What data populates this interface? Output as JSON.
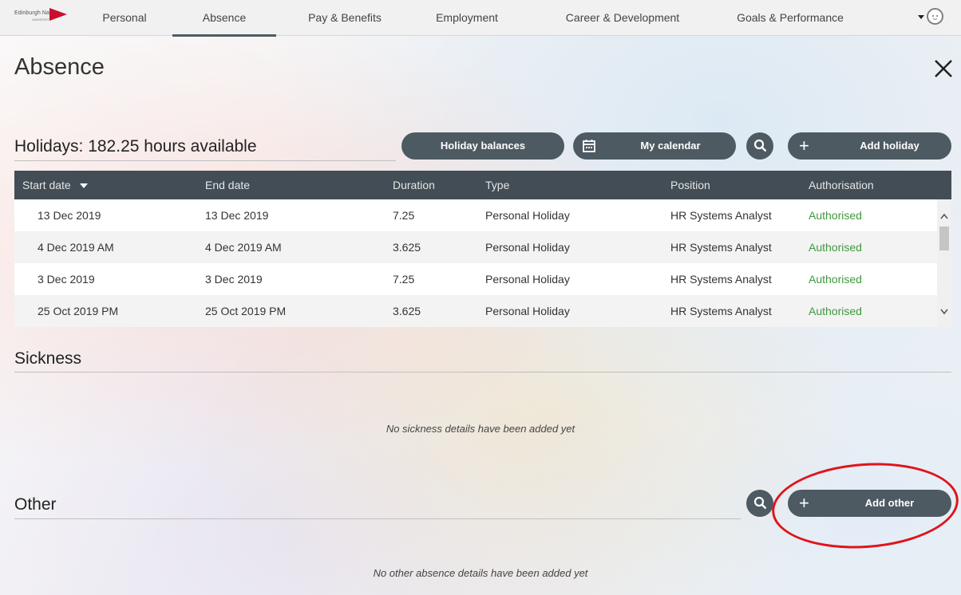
{
  "logo": {
    "text": "Edinburgh Napier",
    "subtext": "UNIVERSITY"
  },
  "nav": {
    "tabs": [
      "Personal",
      "Absence",
      "Pay & Benefits",
      "Employment",
      "Career & Development",
      "Goals & Performance"
    ],
    "active": "Absence"
  },
  "page": {
    "title": "Absence"
  },
  "holidays": {
    "title": "Holidays: 182.25 hours available",
    "buttons": {
      "balances": "Holiday balances",
      "calendar": "My calendar",
      "add": "Add holiday"
    },
    "columns": [
      "Start date",
      "End date",
      "Duration",
      "Type",
      "Position",
      "Authorisation"
    ],
    "rows": [
      [
        "13 Dec 2019",
        "13 Dec 2019",
        "7.25",
        "Personal Holiday",
        "HR Systems Analyst",
        "Authorised"
      ],
      [
        "4 Dec 2019 AM",
        "4 Dec 2019 AM",
        "3.625",
        "Personal Holiday",
        "HR Systems Analyst",
        "Authorised"
      ],
      [
        "3 Dec 2019",
        "3 Dec 2019",
        "7.25",
        "Personal Holiday",
        "HR Systems Analyst",
        "Authorised"
      ],
      [
        "25 Oct 2019 PM",
        "25 Oct 2019 PM",
        "3.625",
        "Personal Holiday",
        "HR Systems Analyst",
        "Authorised"
      ]
    ]
  },
  "sickness": {
    "title": "Sickness",
    "empty": "No sickness details have been added yet"
  },
  "other": {
    "title": "Other",
    "add": "Add other",
    "empty": "No other absence details have been added yet"
  },
  "icons": {
    "close": "close-icon",
    "search": "search-icon",
    "calendar": "calendar-icon",
    "plus": "plus-icon",
    "sort": "caret-down-icon",
    "scroll_up": "chevron-up-icon",
    "scroll_down": "chevron-down-icon",
    "user": "avatar-icon"
  },
  "colors": {
    "button": "#4d5a62",
    "header": "#424d55",
    "authorised": "#3e9a3e",
    "annotation": "#e0141b"
  }
}
